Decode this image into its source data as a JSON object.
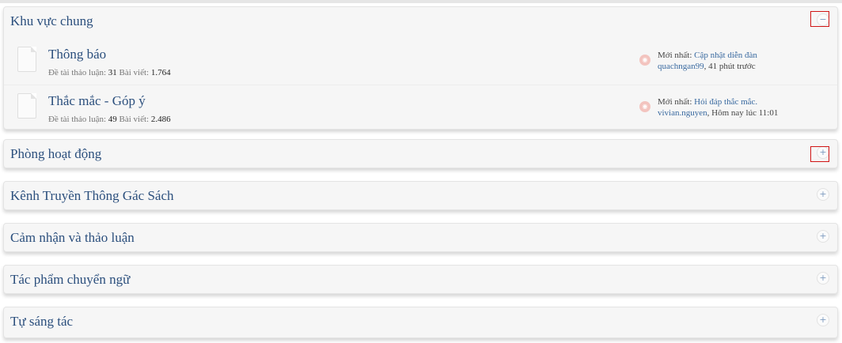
{
  "categories": [
    {
      "title": "Khu vực chung",
      "toggle": "−",
      "forums": [
        {
          "title": "Thông báo",
          "threads_label": "Đề tài thảo luận:",
          "threads": "31",
          "posts_label": "Bài viết:",
          "posts": "1.764",
          "latest_label": "Mới nhất:",
          "latest_thread": "Cập nhật diễn đàn",
          "latest_user": "quachngan99",
          "latest_time": ", 41 phút trước"
        },
        {
          "title": "Thắc mắc - Góp ý",
          "threads_label": "Đề tài thảo luận:",
          "threads": "49",
          "posts_label": "Bài viết:",
          "posts": "2.486",
          "latest_label": "Mới nhất:",
          "latest_thread": "Hỏi đáp thắc mắc.",
          "latest_user": "vivian.nguyen",
          "latest_time": ", Hôm nay lúc 11:01"
        }
      ]
    },
    {
      "title": "Phòng hoạt động",
      "toggle": "+"
    },
    {
      "title": "Kênh Truyền Thông Gác Sách",
      "toggle": "+"
    },
    {
      "title": "Cảm nhận và thảo luận",
      "toggle": "+"
    },
    {
      "title": "Tác phẩm chuyển ngữ",
      "toggle": "+"
    },
    {
      "title": "Tự sáng tác",
      "toggle": "+"
    }
  ],
  "rss_icon": "rss-icon",
  "doc_icon": "document-icon",
  "colors": {
    "link": "#2b4f7d",
    "highlight": "#d01616",
    "rss": "#f3c4bf"
  }
}
